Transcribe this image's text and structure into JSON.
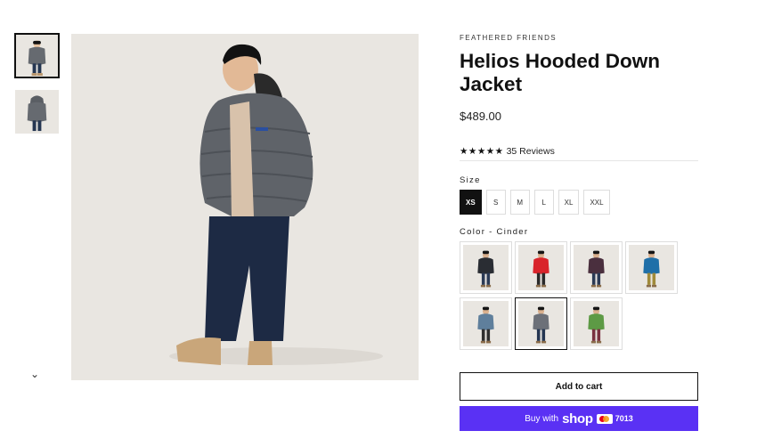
{
  "product": {
    "brand": "FEATHERED FRIENDS",
    "title": "Helios Hooded Down Jacket",
    "price": "$489.00",
    "rating": {
      "stars": "★★★★★",
      "reviews": "35 Reviews",
      "value": 5
    }
  },
  "size": {
    "label": "Size",
    "options": [
      "XS",
      "S",
      "M",
      "L",
      "XL",
      "XXL"
    ],
    "selected": "XS"
  },
  "color": {
    "label": "Color - Cinder",
    "swatches": [
      {
        "jacket": "#2a2d33",
        "pants": "#2b3a55",
        "selected": false
      },
      {
        "jacket": "#d9242b",
        "pants": "#2a2a2a",
        "selected": false
      },
      {
        "jacket": "#4a2f3e",
        "pants": "#2b3a55",
        "selected": false
      },
      {
        "jacket": "#1f6fa8",
        "pants": "#a08a3a",
        "selected": false
      },
      {
        "jacket": "#5f7f9c",
        "pants": "#2f2f2f",
        "selected": false
      },
      {
        "jacket": "#6c7078",
        "pants": "#253652",
        "selected": true
      },
      {
        "jacket": "#5d9a45",
        "pants": "#7a3040",
        "selected": false
      }
    ]
  },
  "thumbnails": {
    "more_icon": "chevron-down-icon",
    "more_glyph": "⌄"
  },
  "buttons": {
    "add_to_cart": "Add to cart",
    "buy_with": "Buy with",
    "shop": "shop",
    "card_last4": "7013"
  },
  "colors": {
    "accent": "#5a31f4",
    "background": "#e9e6e1"
  }
}
